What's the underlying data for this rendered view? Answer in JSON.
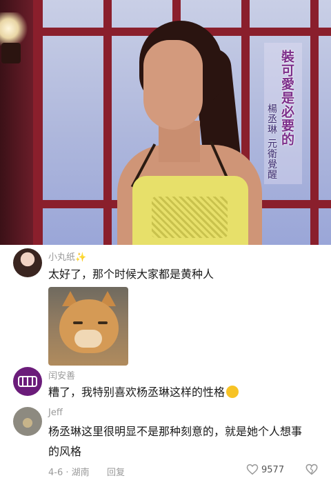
{
  "video": {
    "caption_main": "裝可愛是必要的",
    "caption_sub": "楊丞琳 元衛覺醒"
  },
  "comments": [
    {
      "username": "小丸纸✨",
      "text": "太好了，那个时候大家都是黄种人",
      "has_image": true,
      "image_desc_icon": "cat-meme-image"
    },
    {
      "username": "闰安善",
      "text": "糟了，我特别喜欢杨丞琳这样的性格"
    },
    {
      "username": "Jeff",
      "text_line1": "杨丞琳这里很明显不是那种刻意的，就是她个人想事",
      "text_line2": "的风格",
      "meta": "4-6 · 湖南",
      "reply_label": "回复",
      "like_count": "9577"
    }
  ],
  "colors": {
    "username": "#999999",
    "comment_text": "#1a1a1a",
    "caption_purple": "#7c2e8a",
    "avatar2_bg": "#6b1c7a"
  }
}
